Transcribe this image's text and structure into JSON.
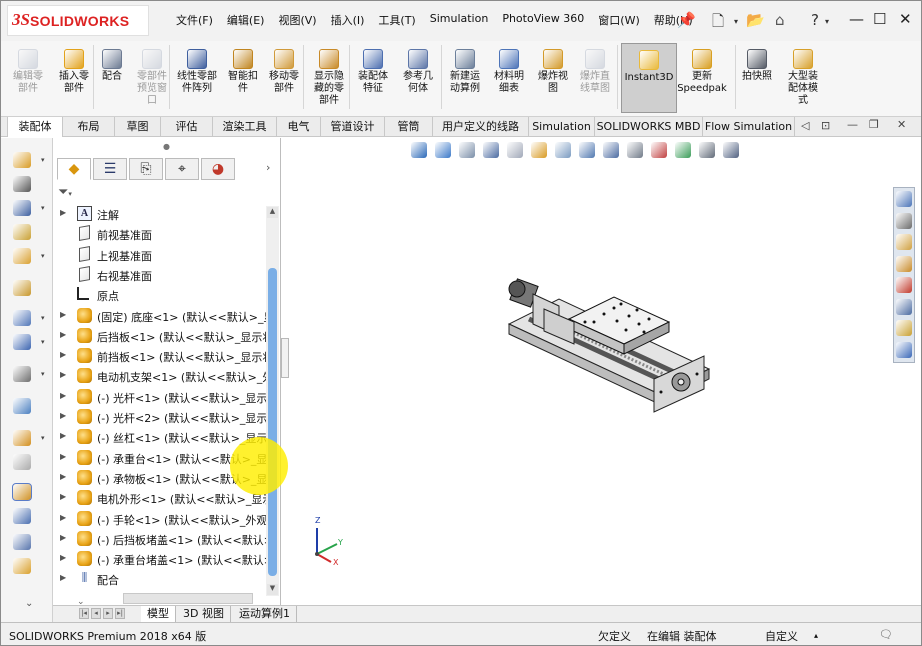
{
  "app": {
    "logo": {
      "mark": "3S",
      "name": "SOLIDWORKS"
    },
    "menu": [
      "文件(F)",
      "编辑(E)",
      "视图(V)",
      "插入(I)",
      "工具(T)",
      "Simulation",
      "PhotoView 360",
      "窗口(W)",
      "帮助(H)"
    ]
  },
  "ribbon": [
    {
      "label": "编辑零\n部件",
      "disabled": true,
      "icon": "edit-component-icon",
      "color": "#9aa4b8"
    },
    {
      "label": "插入零\n部件",
      "disabled": false,
      "icon": "insert-component-icon",
      "color": "#e2a21b"
    },
    {
      "label": "配合",
      "disabled": false,
      "icon": "mate-icon",
      "color": "#6c7a92"
    },
    {
      "label": "零部件\n预览窗\n口",
      "disabled": true,
      "icon": "preview-icon",
      "color": "#9aa4b8"
    },
    {
      "label": "线性零部\n件阵列",
      "disabled": false,
      "icon": "linear-pattern-icon",
      "color": "#3f5f9e"
    },
    {
      "label": "智能扣\n件",
      "disabled": false,
      "icon": "smart-fastener-icon",
      "color": "#c08520"
    },
    {
      "label": "移动零\n部件",
      "disabled": false,
      "icon": "move-component-icon",
      "color": "#d09a3a"
    },
    {
      "label": "显示隐\n藏的零\n部件",
      "disabled": false,
      "icon": "show-hidden-icon",
      "color": "#c88a28"
    },
    {
      "label": "装配体\n特征",
      "disabled": false,
      "icon": "assembly-feature-icon",
      "color": "#4d6fb0"
    },
    {
      "label": "参考几\n何体",
      "disabled": false,
      "icon": "reference-geometry-icon",
      "color": "#5d76a8"
    },
    {
      "label": "新建运\n动算例",
      "disabled": false,
      "icon": "motion-study-icon",
      "color": "#6c7f9a"
    },
    {
      "label": "材料明\n细表",
      "disabled": false,
      "icon": "bom-icon",
      "color": "#4d74b8"
    },
    {
      "label": "爆炸视\n图",
      "disabled": false,
      "icon": "exploded-view-icon",
      "color": "#d39a2a"
    },
    {
      "label": "爆炸直\n线草图",
      "disabled": true,
      "icon": "explode-line-icon",
      "color": "#9aa4b8"
    },
    {
      "label": "Instant3D",
      "disabled": false,
      "active": true,
      "icon": "instant3d-icon",
      "color": "#e9b93a"
    },
    {
      "label": "更新\nSpeedpak",
      "disabled": false,
      "icon": "speedpak-icon",
      "color": "#d89f22"
    },
    {
      "label": "拍快照",
      "disabled": false,
      "icon": "snapshot-icon",
      "color": "#555b66"
    },
    {
      "label": "大型装\n配体模\n式",
      "disabled": false,
      "icon": "large-assembly-icon",
      "color": "#d7a02a"
    }
  ],
  "tabs": [
    "装配体",
    "布局",
    "草图",
    "评估",
    "渲染工具",
    "电气",
    "管道设计",
    "管筒",
    "用户定义的线路",
    "Simulation",
    "SOLIDWORKS MBD",
    "Flow Simulation"
  ],
  "feature_tree": [
    {
      "label": "注解",
      "type": "note",
      "expand": true
    },
    {
      "label": "前视基准面",
      "type": "plane",
      "expand": false
    },
    {
      "label": "上视基准面",
      "type": "plane",
      "expand": false
    },
    {
      "label": "右视基准面",
      "type": "plane",
      "expand": false
    },
    {
      "label": "原点",
      "type": "origin",
      "expand": false
    },
    {
      "label": "(固定) 底座<1> (默认<<默认>_显",
      "type": "part",
      "expand": true
    },
    {
      "label": "后挡板<1> (默认<<默认>_显示状",
      "type": "part",
      "expand": true
    },
    {
      "label": "前挡板<1> (默认<<默认>_显示状",
      "type": "part",
      "expand": true
    },
    {
      "label": "电动机支架<1> (默认<<默认>_外",
      "type": "part",
      "expand": true
    },
    {
      "label": "(-) 光杆<1> (默认<<默认>_显示状",
      "type": "part",
      "expand": true
    },
    {
      "label": "(-) 光杆<2> (默认<<默认>_显示状",
      "type": "part",
      "expand": true
    },
    {
      "label": "(-) 丝杠<1> (默认<<默认>_显示状",
      "type": "part",
      "expand": true
    },
    {
      "label": "(-) 承重台<1> (默认<<默认>_显示",
      "type": "part",
      "expand": true
    },
    {
      "label": "(-) 承物板<1> (默认<<默认>_显示",
      "type": "part",
      "expand": true
    },
    {
      "label": "电机外形<1> (默认<<默认>_显示",
      "type": "part",
      "expand": true
    },
    {
      "label": "(-) 手轮<1> (默认<<默认>_外观",
      "type": "part",
      "expand": true
    },
    {
      "label": "(-) 后挡板堵盖<1> (默认<<默认>",
      "type": "part",
      "expand": true
    },
    {
      "label": "(-) 承重台堵盖<1> (默认<<默认>",
      "type": "part",
      "expand": true
    },
    {
      "label": "配合",
      "type": "mate",
      "expand": true
    }
  ],
  "bottom_tabs": [
    "模型",
    "3D 视图",
    "运动算例1"
  ],
  "status": {
    "product": "SOLIDWORKS Premium 2018 x64 版",
    "definition": "欠定义",
    "editing": "在编辑 装配体",
    "custom": "自定义"
  },
  "triad": {
    "z": "Z",
    "x": "X",
    "y": "Y"
  }
}
